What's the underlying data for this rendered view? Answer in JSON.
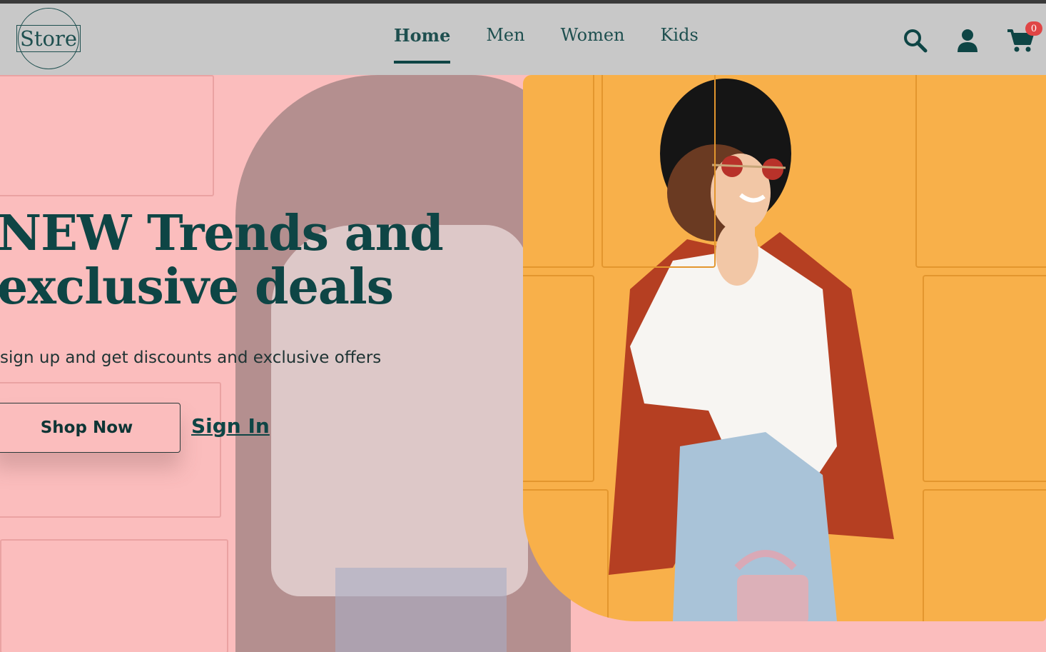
{
  "header": {
    "logo_text": "Store",
    "nav": [
      {
        "label": "Home",
        "active": true
      },
      {
        "label": "Men",
        "active": false
      },
      {
        "label": "Women",
        "active": false
      },
      {
        "label": "Kids",
        "active": false
      }
    ],
    "cart_count": "0"
  },
  "hero": {
    "headline_line1": "NEW Trends and",
    "headline_line2": "exclusive deals",
    "subtitle": "sign up and get discounts and exclusive offers",
    "shop_button": "Shop Now",
    "signin_link": "Sign In"
  },
  "colors": {
    "primary": "#0e4545",
    "header_bg": "#c8c8c8",
    "hero_left_bg": "#fbbdbd",
    "hero_image_bg": "#f8b04a",
    "badge": "#e04545"
  },
  "icons": [
    "search-icon",
    "user-icon",
    "cart-icon"
  ]
}
